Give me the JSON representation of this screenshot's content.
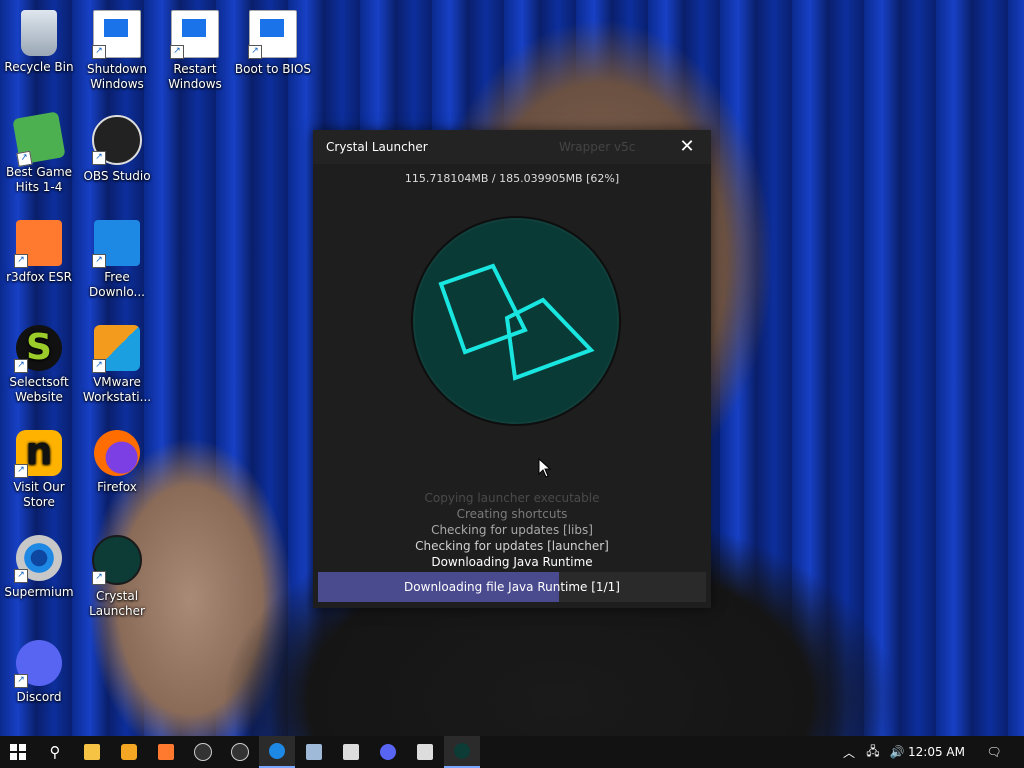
{
  "desktop": {
    "icons": [
      {
        "label": "Recycle Bin",
        "icon": "recycle-bin-icon"
      },
      {
        "label": "Shutdown Windows",
        "icon": "shutdown-windows-icon"
      },
      {
        "label": "Restart Windows",
        "icon": "restart-windows-icon"
      },
      {
        "label": "Boot to BIOS",
        "icon": "boot-to-bios-icon"
      },
      {
        "label": "Best Game Hits 1-4",
        "icon": "dice-icon"
      },
      {
        "label": "OBS Studio",
        "icon": "obs-icon"
      },
      {
        "label": "r3dfox ESR",
        "icon": "r3dfox-icon"
      },
      {
        "label": "Free Downlo...",
        "icon": "free-download-manager-icon"
      },
      {
        "label": "Selectsoft Website",
        "icon": "selectsoft-icon"
      },
      {
        "label": "VMware Workstati...",
        "icon": "vmware-icon"
      },
      {
        "label": "Visit Our Store",
        "icon": "store-icon"
      },
      {
        "label": "Firefox",
        "icon": "firefox-icon"
      },
      {
        "label": "Supermium",
        "icon": "supermium-icon"
      },
      {
        "label": "Crystal Launcher",
        "icon": "crystal-launcher-icon"
      },
      {
        "label": "Discord",
        "icon": "discord-icon"
      }
    ]
  },
  "launcher": {
    "title": "Crystal Launcher",
    "ghost_text": "Wrapper v5c",
    "close_glyph": "✕",
    "download_size": "115.718104MB / 185.039905MB [62%]",
    "log": [
      "Copying launcher executable",
      "Creating shortcuts",
      "Checking for updates [libs]",
      "Checking for updates [launcher]",
      "Downloading Java Runtime"
    ],
    "progress": {
      "label": "Downloading file Java Runtime [1/1]",
      "fraction": 0.62,
      "fill_color": "#4a4a8e"
    },
    "logo_color": "#19e6e0"
  },
  "taskbar": {
    "clock": "12:05 AM",
    "items": [
      "start-icon",
      "search-icon",
      "file-explorer-icon",
      "taskview-icon",
      "r3dfox-icon",
      "obs-icon",
      "obs-icon",
      "supermium-icon",
      "image-viewer-icon",
      "app-icon",
      "discord-icon",
      "app-icon",
      "crystal-launcher-icon"
    ]
  }
}
